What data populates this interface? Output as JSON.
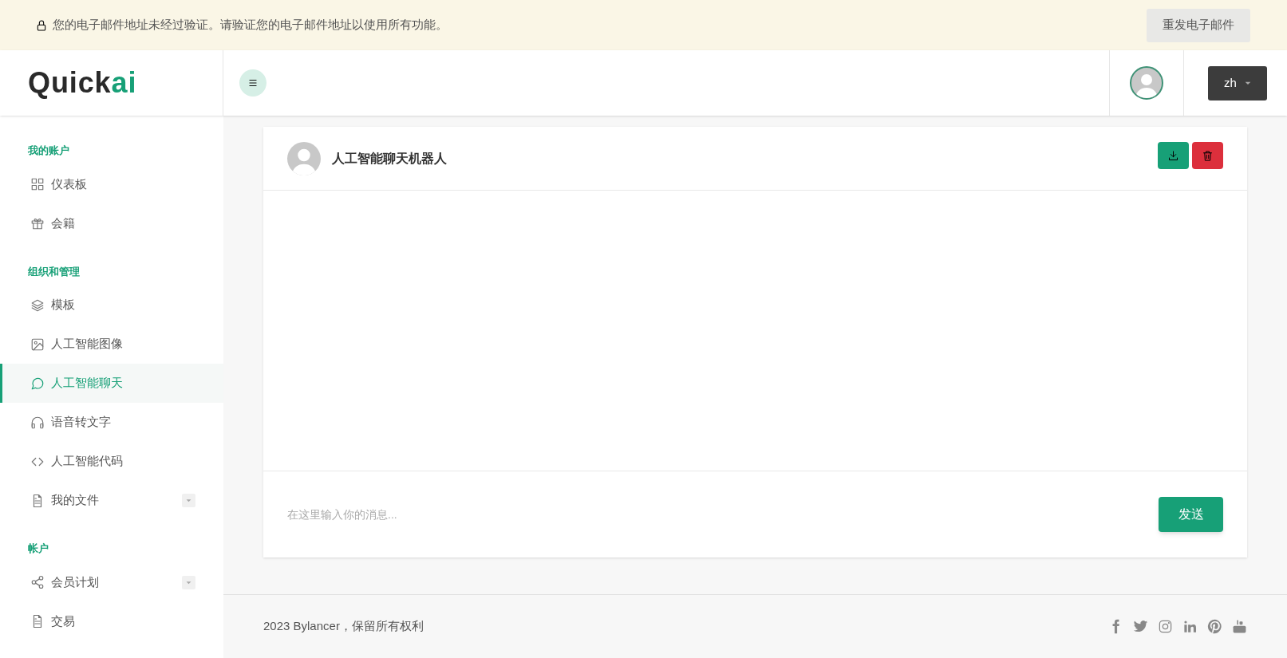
{
  "banner": {
    "message": "您的电子邮件地址未经过验证。请验证您的电子邮件地址以使用所有功能。",
    "button": "重发电子邮件"
  },
  "header": {
    "logo": {
      "text": "Quick",
      "accent": "ai"
    },
    "language": "zh"
  },
  "sidebar": {
    "sections": [
      {
        "title": "我的账户",
        "items": [
          {
            "label": "仪表板",
            "selected": false,
            "dropdown": false
          },
          {
            "label": "会籍",
            "selected": false,
            "dropdown": false
          }
        ]
      },
      {
        "title": "组织和管理",
        "items": [
          {
            "label": "模板",
            "selected": false,
            "dropdown": false
          },
          {
            "label": "人工智能图像",
            "selected": false,
            "dropdown": false
          },
          {
            "label": "人工智能聊天",
            "selected": true,
            "dropdown": false
          },
          {
            "label": "语音转文字",
            "selected": false,
            "dropdown": false
          },
          {
            "label": "人工智能代码",
            "selected": false,
            "dropdown": false
          },
          {
            "label": "我的文件",
            "selected": false,
            "dropdown": true
          }
        ]
      },
      {
        "title": "帐户",
        "items": [
          {
            "label": "会员计划",
            "selected": false,
            "dropdown": true
          },
          {
            "label": "交易",
            "selected": false,
            "dropdown": false
          }
        ]
      }
    ]
  },
  "chat": {
    "title": "人工智能聊天机器人",
    "input": {
      "placeholder": "在这里输入你的消息..."
    },
    "send": "发送"
  },
  "footer": {
    "copyright": "2023 Bylancer，保留所有权利"
  }
}
